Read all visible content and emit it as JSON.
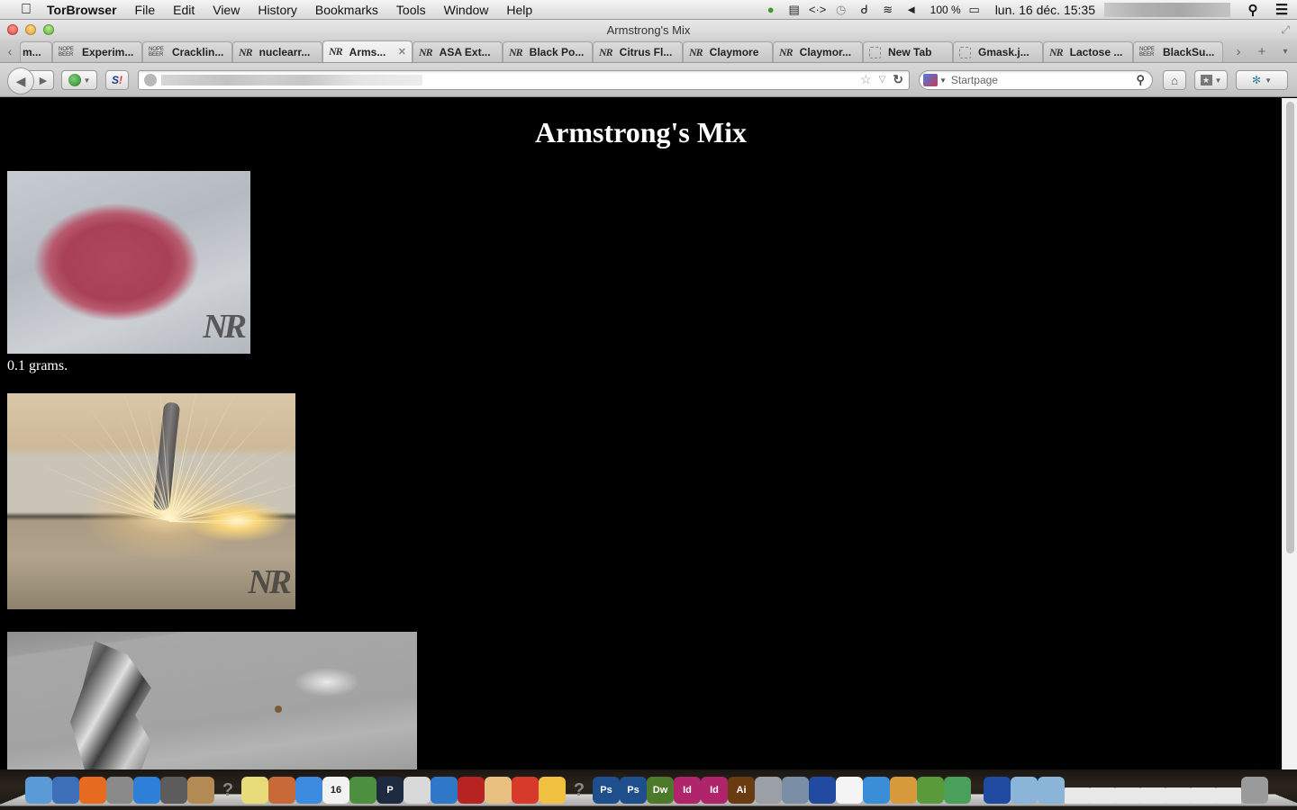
{
  "menubar": {
    "apple_icon": "apple-logo",
    "app_name": "TorBrowser",
    "items": [
      "File",
      "Edit",
      "View",
      "History",
      "Bookmarks",
      "Tools",
      "Window",
      "Help"
    ],
    "status_icons": [
      "growl-icon",
      "battery-monitor-icon",
      "code-icon",
      "time-machine-icon",
      "bluetooth-icon",
      "wifi-icon",
      "volume-icon"
    ],
    "battery_text": "100 %",
    "clock": "lun. 16 déc.  15:35"
  },
  "window": {
    "title": "Armstrong's Mix"
  },
  "tabs": [
    {
      "label": "m...",
      "favicon": "none",
      "selected": false
    },
    {
      "label": "Experim...",
      "favicon": "nope-beer",
      "selected": false
    },
    {
      "label": "Cracklin...",
      "favicon": "nope-beer",
      "selected": false
    },
    {
      "label": "nuclearr...",
      "favicon": "nr",
      "selected": false
    },
    {
      "label": "Arms...",
      "favicon": "nr",
      "selected": true
    },
    {
      "label": "ASA Ext...",
      "favicon": "nr",
      "selected": false
    },
    {
      "label": "Black Po...",
      "favicon": "nr",
      "selected": false
    },
    {
      "label": "Citrus Fl...",
      "favicon": "nr",
      "selected": false
    },
    {
      "label": "Claymore",
      "favicon": "nr",
      "selected": false
    },
    {
      "label": "Claymor...",
      "favicon": "nr",
      "selected": false
    },
    {
      "label": "New Tab",
      "favicon": "blank",
      "selected": false
    },
    {
      "label": "Gmask.j...",
      "favicon": "blank",
      "selected": false
    },
    {
      "label": "Lactose ...",
      "favicon": "nr",
      "selected": false
    },
    {
      "label": "BlackSu...",
      "favicon": "nope-beer",
      "selected": false
    }
  ],
  "favicon_text": {
    "nr": "NR",
    "nope_beer_top": "NOPE",
    "nope_beer_bottom": "BEER"
  },
  "tabstrip": {
    "scroll_left": "‹",
    "scroll_right": "›",
    "new_tab": "+",
    "list_all": "▾",
    "close_tab": "✕"
  },
  "navbar": {
    "back": "◀",
    "forward": "▶",
    "url_value": "",
    "search_placeholder": "Startpage",
    "search_value": ""
  },
  "page": {
    "heading": "Armstrong's Mix",
    "images": [
      {
        "alt": "Pile of pink-red powder on gray surface",
        "watermark": "NR"
      },
      {
        "alt": "Sparks flying from metal rod igniting on surface",
        "watermark": "NR"
      },
      {
        "alt": "Foil fragments on splattered gray surface",
        "watermark": ""
      }
    ],
    "captions": [
      "0.1 grams."
    ]
  },
  "scrollbar": {
    "position_fraction": 0.0,
    "visible_fraction": 0.68
  },
  "dock": {
    "apps": [
      "Finder",
      "Thunderbird",
      "Firefox",
      "Launchpad",
      "App Store",
      "Preview",
      "Contacts",
      "Unknown",
      "Stickies",
      "Keynote",
      "Dropbox",
      "Calendar",
      "Numbers",
      "Pandora",
      "Printer",
      "iTunes",
      "Photo Booth",
      "TextEdit",
      "Tomato",
      "Cyberduck",
      "Unknown",
      "Photoshop",
      "Photoshop",
      "Dreamweaver",
      "InDesign",
      "InDesign",
      "Illustrator",
      "Automator",
      "iPhoto",
      "Transmit",
      "Document",
      "Safari",
      "Archive Utility",
      "Tor",
      "Network",
      "Transmit",
      "Folder",
      "Folder",
      "Window",
      "Window",
      "Window",
      "Window",
      "Window",
      "Window",
      "Window",
      "Trash"
    ],
    "calendar_day": "16"
  }
}
